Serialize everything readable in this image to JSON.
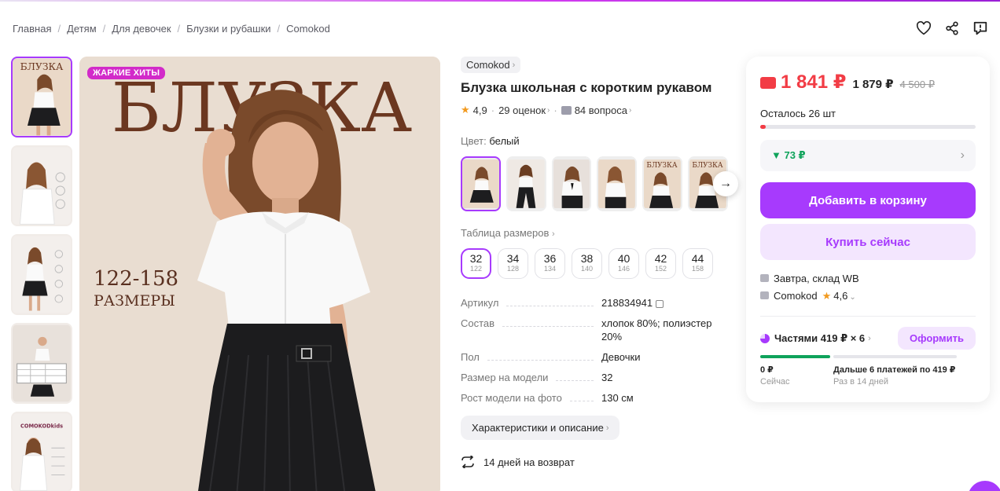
{
  "breadcrumb": [
    "Главная",
    "Детям",
    "Для девочек",
    "Блузки и рубашки",
    "Comokod"
  ],
  "top_actions": [
    "heart-icon",
    "share-icon",
    "report-icon"
  ],
  "gallery": {
    "badge": "ЖАРКИЕ ХИТЫ",
    "main_title": "БЛУЗКА",
    "main_sizes": "122-158",
    "main_sizes_label": "РАЗМЕРЫ",
    "thumb_title": "БЛУЗКА",
    "thumb_brand": "COMOKODkids"
  },
  "product": {
    "brand": "Comokod",
    "title": "Блузка школьная с коротким рукавом",
    "rating": "4,9",
    "reviews": "29 оценок",
    "questions": "84 вопроса",
    "color_label": "Цвет:",
    "color_value": "белый",
    "swatch_text": "БЛУЗКА",
    "size_table_label": "Таблица размеров",
    "sizes": [
      {
        "eu": "32",
        "height": "122"
      },
      {
        "eu": "34",
        "height": "128"
      },
      {
        "eu": "36",
        "height": "134"
      },
      {
        "eu": "38",
        "height": "140"
      },
      {
        "eu": "40",
        "height": "146"
      },
      {
        "eu": "42",
        "height": "152"
      },
      {
        "eu": "44",
        "height": "158"
      }
    ],
    "params": [
      {
        "k": "Артикул",
        "v": "218834941"
      },
      {
        "k": "Состав",
        "v": "хлопок 80%; полиэстер 20%"
      },
      {
        "k": "Пол",
        "v": "Девочки"
      },
      {
        "k": "Размер на модели",
        "v": "32"
      },
      {
        "k": "Рост модели на фото",
        "v": "130 см"
      }
    ],
    "chars_button": "Характеристики и описание",
    "return_text": "14 дней на возврат"
  },
  "card": {
    "price": "1 841 ₽",
    "price_no_wallet": "1 879 ₽",
    "price_old": "4 500 ₽",
    "stock_text": "Осталось 26 шт",
    "stock_fraction": 0.025,
    "discount": "▼ 73 ₽",
    "add_to_cart": "Добавить в корзину",
    "buy_now": "Купить сейчас",
    "delivery": "Завтра, склад WB",
    "seller": "Comokod",
    "seller_rating": "4,6",
    "installments": "Частями 419 ₽ × 6",
    "order_button": "Оформить",
    "now_value": "0 ₽",
    "now_label": "Сейчас",
    "later_value": "Дальше 6 платежей по 419 ₽",
    "later_label": "Раз в 14 дней"
  },
  "colors": {
    "accent": "#a73afd",
    "price": "#f23c45",
    "discount": "#0fa35b"
  }
}
